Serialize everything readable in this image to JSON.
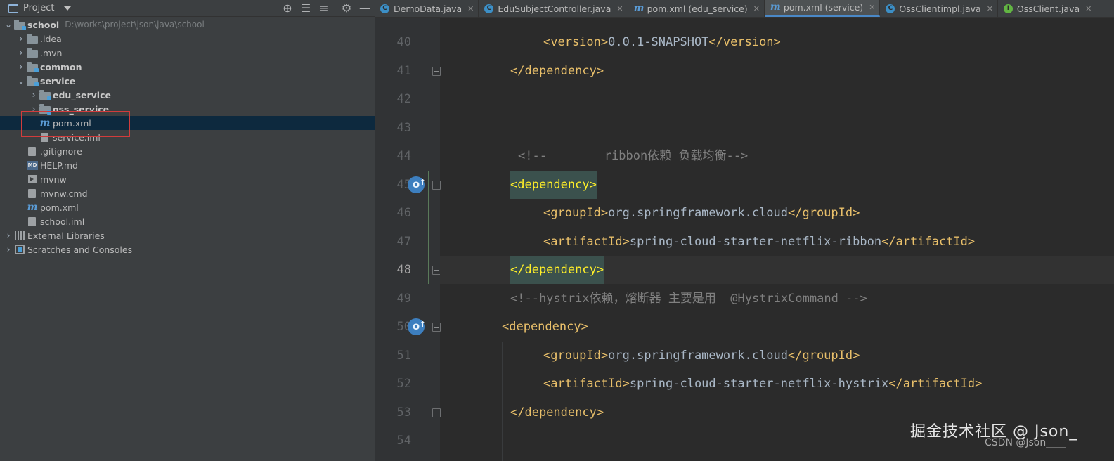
{
  "project_panel": {
    "title": "Project",
    "tree": [
      {
        "label": "school",
        "hint": "D:\\works\\project\\json\\java\\school",
        "icon": "module-folder-icon",
        "expanded": true
      },
      {
        "label": ".idea",
        "icon": "folder-icon",
        "expanded": false
      },
      {
        "label": ".mvn",
        "icon": "folder-icon",
        "expanded": false
      },
      {
        "label": "common",
        "icon": "module-folder-icon",
        "expanded": false
      },
      {
        "label": "service",
        "icon": "module-folder-icon",
        "expanded": true
      },
      {
        "label": "edu_service",
        "icon": "module-folder-icon",
        "expanded": false
      },
      {
        "label": "oss_service",
        "icon": "module-folder-icon",
        "expanded": false
      },
      {
        "label": "pom.xml",
        "icon": "maven-icon",
        "selected": true
      },
      {
        "label": "service.iml",
        "icon": "iml-file-icon"
      },
      {
        "label": ".gitignore",
        "icon": "gitignore-file-icon"
      },
      {
        "label": "HELP.md",
        "icon": "markdown-file-icon"
      },
      {
        "label": "mvnw",
        "icon": "shell-script-icon"
      },
      {
        "label": "mvnw.cmd",
        "icon": "cmd-file-icon"
      },
      {
        "label": "pom.xml",
        "icon": "maven-icon"
      },
      {
        "label": "school.iml",
        "icon": "iml-file-icon"
      },
      {
        "label": "External Libraries",
        "icon": "libraries-icon",
        "expanded": false
      },
      {
        "label": "Scratches and Consoles",
        "icon": "scratches-icon",
        "expanded": false
      }
    ]
  },
  "tabs": [
    {
      "label": "DemoData.java",
      "icon": "class-icon",
      "active": false
    },
    {
      "label": "EduSubjectController.java",
      "icon": "class-icon",
      "active": false
    },
    {
      "label": "pom.xml (edu_service)",
      "icon": "maven-icon",
      "active": false
    },
    {
      "label": "pom.xml (service)",
      "icon": "maven-icon",
      "active": true
    },
    {
      "label": "OssClientimpl.java",
      "icon": "class-icon",
      "active": false
    },
    {
      "label": "OssClient.java",
      "icon": "interface-icon",
      "active": false
    }
  ],
  "editor": {
    "current_line": 48,
    "lines": [
      {
        "n": 40,
        "text": "<version>0.0.1-SNAPSHOT</version>"
      },
      {
        "n": 41,
        "text": "</dependency>"
      },
      {
        "n": 42,
        "text": ""
      },
      {
        "n": 43,
        "text": ""
      },
      {
        "n": 44,
        "text": "<!--        ribbon依赖 负载均衡-->"
      },
      {
        "n": 45,
        "text": "<dependency>"
      },
      {
        "n": 46,
        "text": "<groupId>org.springframework.cloud</groupId>"
      },
      {
        "n": 47,
        "text": "<artifactId>spring-cloud-starter-netflix-ribbon</artifactId>"
      },
      {
        "n": 48,
        "text": "</dependency>"
      },
      {
        "n": 49,
        "text": "<!--hystrix依赖，熔断器 主要是用  @HystrixCommand -->"
      },
      {
        "n": 50,
        "text": "<dependency>"
      },
      {
        "n": 51,
        "text": "<groupId>org.springframework.cloud</groupId>"
      },
      {
        "n": 52,
        "text": "<artifactId>spring-cloud-starter-netflix-hystrix</artifactId>"
      },
      {
        "n": 53,
        "text": "</dependency>"
      },
      {
        "n": 54,
        "text": ""
      }
    ]
  },
  "watermark": {
    "main": "掘金技术社区 @ Json_",
    "sub": "CSDN @Json____"
  },
  "colors": {
    "tag": "#e8bf6a",
    "text": "#a9b7c6",
    "comment": "#808080",
    "selection": "#0d293e",
    "annotation": "#d23c3c"
  }
}
